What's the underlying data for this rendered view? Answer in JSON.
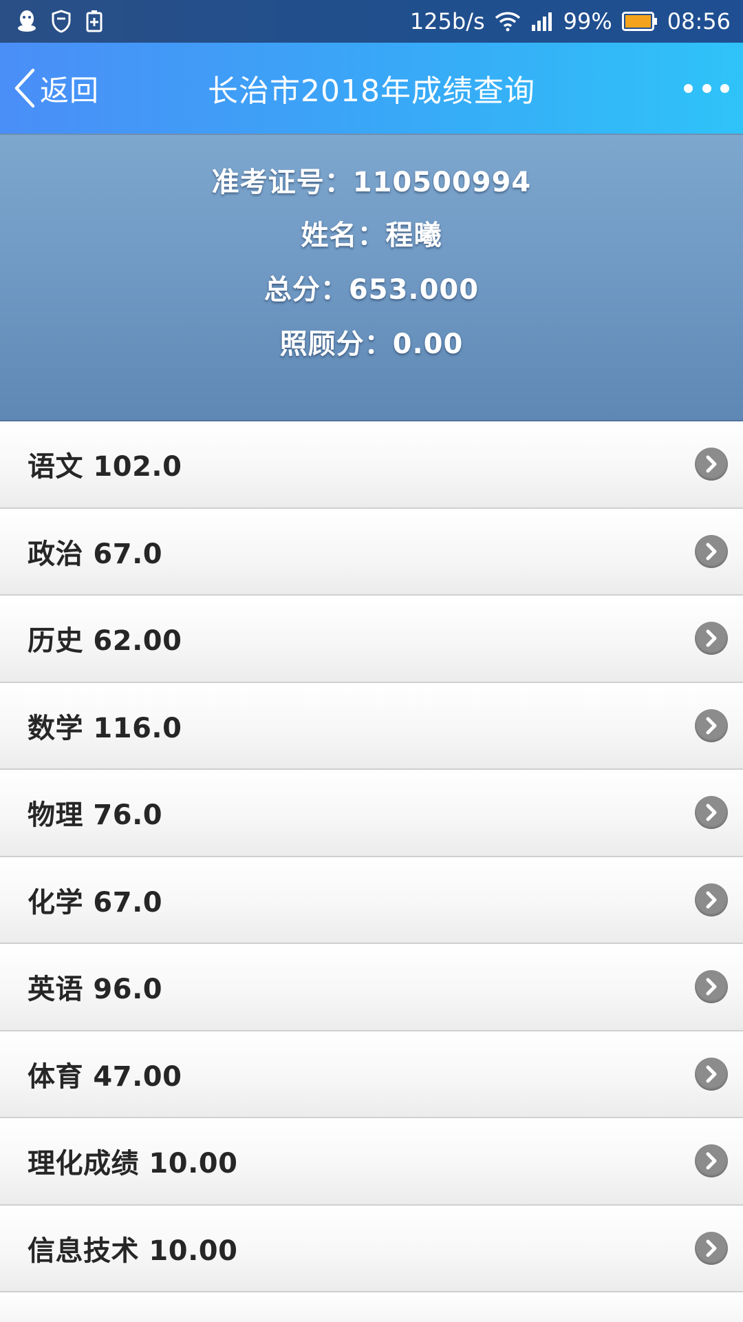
{
  "status_bar": {
    "left_icons": [
      "qq-icon",
      "shield-icon",
      "battery-saver-icon"
    ],
    "net_speed": "125b/s",
    "battery_percent": "99%",
    "time": "08:56"
  },
  "nav": {
    "back_label": "返回",
    "title": "长治市2018年成绩查询",
    "more_icon": "more-icon"
  },
  "info": {
    "exam_id": "准考证号：110500994",
    "name": "姓名：程曦",
    "total": "总分：653.000",
    "bonus": "照顾分：0.00"
  },
  "scores": [
    {
      "label": "语文 102.0"
    },
    {
      "label": "政治 67.0"
    },
    {
      "label": "历史 62.00"
    },
    {
      "label": "数学 116.0"
    },
    {
      "label": "物理 76.0"
    },
    {
      "label": "化学 67.0"
    },
    {
      "label": "英语 96.0"
    },
    {
      "label": "体育 47.00"
    },
    {
      "label": "理化成绩 10.00"
    },
    {
      "label": "信息技术 10.00"
    }
  ],
  "colors": {
    "nav_start": "#4a8ef7",
    "nav_end": "#2fc3f8",
    "panel": "#6f98c3",
    "chevron": "#8c8c8c"
  }
}
